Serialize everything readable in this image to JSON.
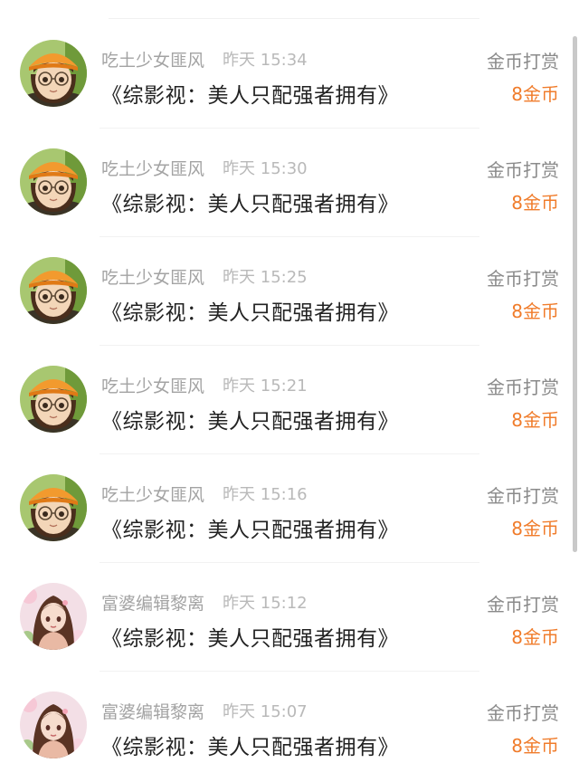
{
  "colors": {
    "accent": "#f07c2b",
    "username": "#a3a3a3",
    "timestamp": "#b9b9b9",
    "title": "#222222",
    "reward_label": "#8a8a8a"
  },
  "rows": [
    {
      "username": "吃土少女匪风",
      "time": "昨天 15:34",
      "title": "《综影视：美人只配强者拥有》",
      "reward_label": "金币打赏",
      "amount": "8金币",
      "avatar_icon": "orange-hat-girl-avatar"
    },
    {
      "username": "吃土少女匪风",
      "time": "昨天 15:30",
      "title": "《综影视：美人只配强者拥有》",
      "reward_label": "金币打赏",
      "amount": "8金币",
      "avatar_icon": "orange-hat-girl-avatar"
    },
    {
      "username": "吃土少女匪风",
      "time": "昨天 15:25",
      "title": "《综影视：美人只配强者拥有》",
      "reward_label": "金币打赏",
      "amount": "8金币",
      "avatar_icon": "orange-hat-girl-avatar"
    },
    {
      "username": "吃土少女匪风",
      "time": "昨天 15:21",
      "title": "《综影视：美人只配强者拥有》",
      "reward_label": "金币打赏",
      "amount": "8金币",
      "avatar_icon": "orange-hat-girl-avatar"
    },
    {
      "username": "吃土少女匪风",
      "time": "昨天 15:16",
      "title": "《综影视：美人只配强者拥有》",
      "reward_label": "金币打赏",
      "amount": "8金币",
      "avatar_icon": "orange-hat-girl-avatar"
    },
    {
      "username": "富婆编辑黎离",
      "time": "昨天 15:12",
      "title": "《综影视：美人只配强者拥有》",
      "reward_label": "金币打赏",
      "amount": "8金币",
      "avatar_icon": "long-hair-woman-avatar"
    },
    {
      "username": "富婆编辑黎离",
      "time": "昨天 15:07",
      "title": "《综影视：美人只配强者拥有》",
      "reward_label": "金币打赏",
      "amount": "8金币",
      "avatar_icon": "long-hair-woman-avatar"
    }
  ]
}
